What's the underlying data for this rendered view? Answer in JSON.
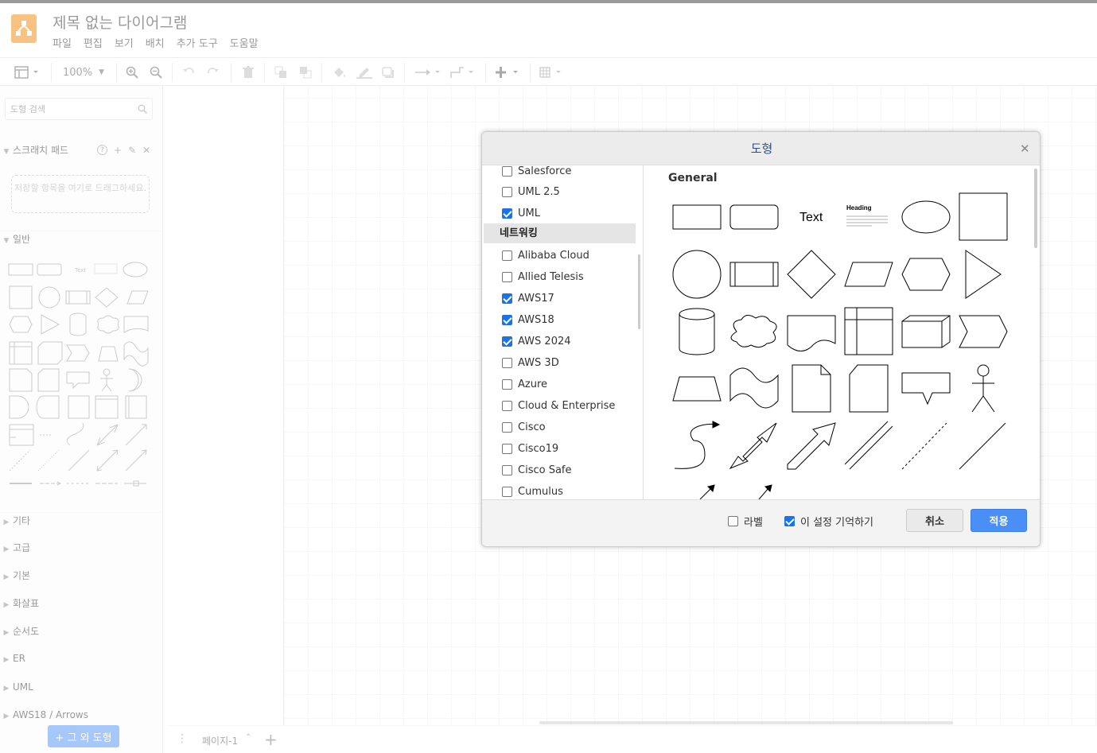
{
  "app": {
    "document_title": "제목 없는 다이어그램",
    "menu": [
      "파일",
      "편집",
      "보기",
      "배치",
      "추가 도구",
      "도움말"
    ],
    "zoom": "100%"
  },
  "sidebar": {
    "search_placeholder": "도형 검색",
    "scratchpad_title": "스크래치 패드",
    "scratchpad_drop_hint": "저장할 항목을 여기로 드래그하세요.",
    "general_title": "일반",
    "general_text_shape": "Text",
    "sections": [
      "기타",
      "고급",
      "기본",
      "화살표",
      "순서도",
      "ER",
      "UML",
      "AWS18 / Arrows"
    ],
    "more_shapes_button": "+ 그 외 도형"
  },
  "bottombar": {
    "page_tab": "페이지-1"
  },
  "dialog": {
    "title": "도형",
    "libraries": [
      {
        "label": "Salesforce",
        "checked": false
      },
      {
        "label": "UML 2.5",
        "checked": false
      },
      {
        "label": "UML",
        "checked": true
      }
    ],
    "group_label": "네트워킹",
    "network_libraries": [
      {
        "label": "Alibaba Cloud",
        "checked": false
      },
      {
        "label": "Allied Telesis",
        "checked": false
      },
      {
        "label": "AWS17",
        "checked": true
      },
      {
        "label": "AWS18",
        "checked": true
      },
      {
        "label": "AWS 2024",
        "checked": true
      },
      {
        "label": "AWS 3D",
        "checked": false
      },
      {
        "label": "Azure",
        "checked": false
      },
      {
        "label": "Cloud & Enterprise",
        "checked": false
      },
      {
        "label": "Cisco",
        "checked": false
      },
      {
        "label": "Cisco19",
        "checked": false
      },
      {
        "label": "Cisco Safe",
        "checked": false
      },
      {
        "label": "Cumulus",
        "checked": false
      }
    ],
    "preview_title": "General",
    "preview_text_shape": "Text",
    "preview_heading": "Heading",
    "label_option": "라벨",
    "label_checked": false,
    "remember_option": "이 설정 기억하기",
    "remember_checked": true,
    "cancel_label": "취소",
    "apply_label": "적용"
  },
  "colors": {
    "accent": "#4a8ff5",
    "logo": "#f08705",
    "dialog_title": "#2d4f8c"
  }
}
